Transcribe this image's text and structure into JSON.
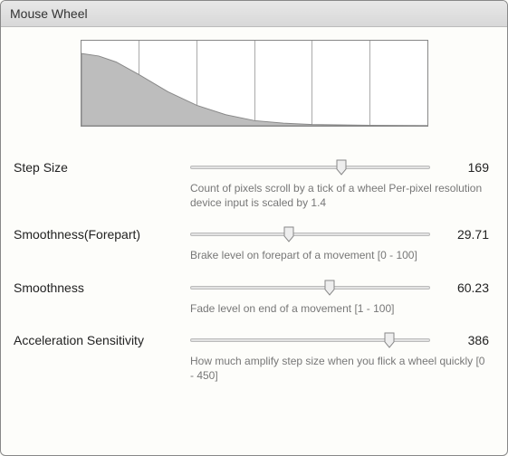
{
  "header": {
    "title": "Mouse Wheel"
  },
  "chart_data": {
    "type": "area",
    "title": "",
    "xlabel": "",
    "ylabel": "",
    "xlim": [
      0,
      6
    ],
    "ylim": [
      0,
      1
    ],
    "x": [
      0,
      0.3,
      0.6,
      1.0,
      1.5,
      2.0,
      2.5,
      3.0,
      3.5,
      4.0,
      5.0,
      6.0
    ],
    "values": [
      0.85,
      0.82,
      0.75,
      0.6,
      0.4,
      0.24,
      0.13,
      0.06,
      0.03,
      0.015,
      0.005,
      0.003
    ]
  },
  "settings": {
    "step_size": {
      "label": "Step Size",
      "value": "169",
      "min": 0,
      "max": 300,
      "percent": 0.63,
      "desc": "Count of pixels scroll by a tick of a wheel\nPer-pixel resolution device input is scaled by 1.4"
    },
    "smooth_fore": {
      "label": "Smoothness(Forepart)",
      "value": "29.71",
      "min": 0,
      "max": 100,
      "percent": 0.41,
      "desc": "Brake level on forepart of a movement [0 - 100]"
    },
    "smooth": {
      "label": "Smoothness",
      "value": "60.23",
      "min": 1,
      "max": 100,
      "percent": 0.58,
      "desc": "Fade level on end of a movement [1 - 100]"
    },
    "accel": {
      "label": "Acceleration Sensitivity",
      "value": "386",
      "min": 0,
      "max": 450,
      "percent": 0.83,
      "desc": "How much amplify step size when you flick a wheel quickly [0 - 450]"
    }
  }
}
